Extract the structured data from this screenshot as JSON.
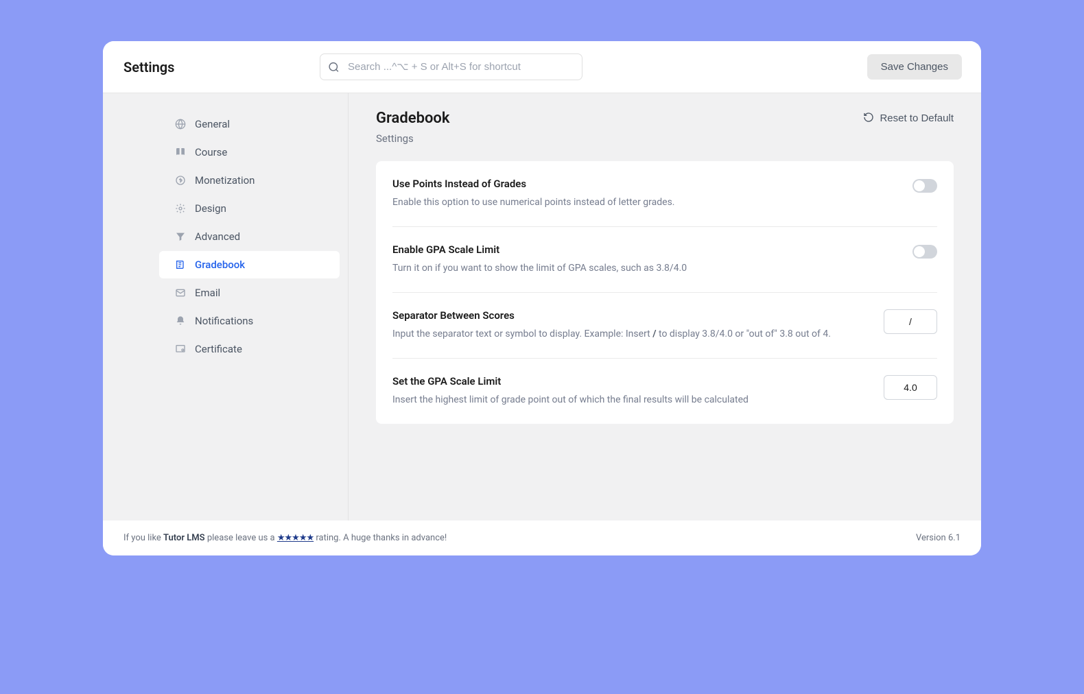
{
  "header": {
    "title": "Settings",
    "search_placeholder": "Search ...^⌥ + S or Alt+S for shortcut",
    "save_label": "Save Changes"
  },
  "sidebar": {
    "items": [
      {
        "label": "General",
        "icon": "globe"
      },
      {
        "label": "Course",
        "icon": "book"
      },
      {
        "label": "Monetization",
        "icon": "monetization"
      },
      {
        "label": "Design",
        "icon": "design"
      },
      {
        "label": "Advanced",
        "icon": "filter"
      },
      {
        "label": "Gradebook",
        "icon": "gradebook",
        "active": true
      },
      {
        "label": "Email",
        "icon": "mail"
      },
      {
        "label": "Notifications",
        "icon": "bell"
      },
      {
        "label": "Certificate",
        "icon": "certificate"
      }
    ]
  },
  "content": {
    "title": "Gradebook",
    "reset_label": "Reset to Default",
    "subtitle": "Settings",
    "settings": [
      {
        "title": "Use Points Instead of Grades",
        "desc": "Enable this option to use numerical points instead of letter grades.",
        "type": "toggle",
        "value": false
      },
      {
        "title": "Enable GPA Scale Limit",
        "desc": "Turn it on if you want to show the limit of GPA scales, such as 3.8/4.0",
        "type": "toggle",
        "value": false
      },
      {
        "title": "Separator Between Scores",
        "desc_prefix": "Input the separator text or symbol to display. Example: Insert ",
        "desc_bold": "/",
        "desc_suffix": " to display 3.8/4.0 or \"out of\" 3.8 out of 4.",
        "type": "text",
        "value": "/"
      },
      {
        "title": "Set the GPA Scale Limit",
        "desc": "Insert the highest limit of grade point out of which the final results will be calculated",
        "type": "text",
        "value": "4.0"
      }
    ]
  },
  "footer": {
    "prefix": "If you like ",
    "brand": "Tutor LMS",
    "middle": " please leave us a ",
    "stars": "★★★★★",
    "suffix": " rating. A huge thanks in advance!",
    "version": "Version 6.1"
  }
}
